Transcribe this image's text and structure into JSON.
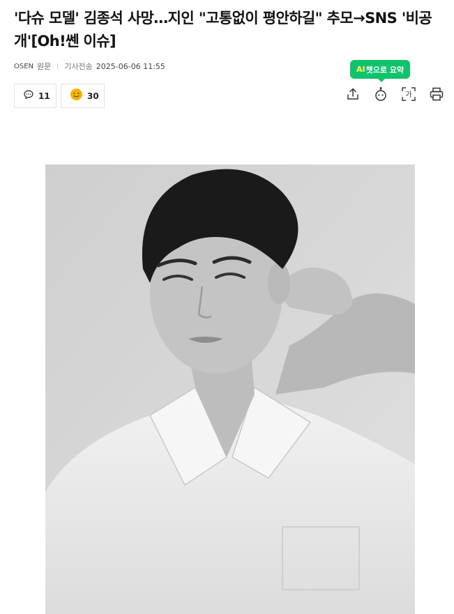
{
  "article": {
    "title": "'다슈 모델' 김종석 사망…지인 \"고통없이 평안하길\" 추모→SNS '비공개'[Oh!쎈 이슈]",
    "press": "OSEN",
    "original_link": "원문",
    "sent_label": "기사전송",
    "datetime": "2025-06-06 11:55"
  },
  "ai_summary": {
    "ai": "AI",
    "label": "챗으로 요약"
  },
  "reactions": {
    "comment_count": "11",
    "emoji_count": "30"
  },
  "toolbar": {
    "icons": [
      "share-icon",
      "bot-icon",
      "font-size-icon",
      "print-icon"
    ],
    "font_glyph": "가"
  },
  "photo": {
    "style": "grayscale portrait"
  },
  "colors": {
    "ai_badge": "#11c26d",
    "ai_text": "#fff35a",
    "emoji_badge": "#f5b400"
  }
}
